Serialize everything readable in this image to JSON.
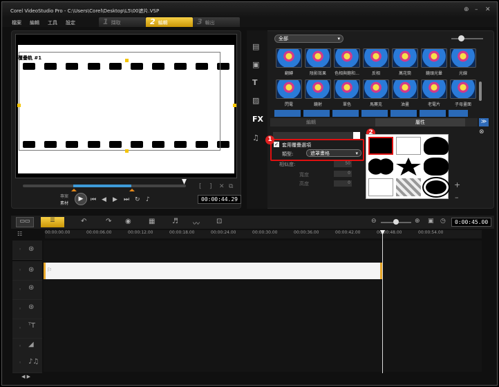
{
  "app": {
    "title": "Corel VideoStudio Pro - C:\\Users\\Corel\\Desktop\\L5\\00遮片.VSP"
  },
  "menu": [
    "檔案",
    "編輯",
    "工具",
    "設定"
  ],
  "steps": [
    {
      "num": "1",
      "label": "擷取"
    },
    {
      "num": "2",
      "label": "編輯"
    },
    {
      "num": "3",
      "label": "輸出"
    }
  ],
  "preview": {
    "overlay_tag": "覆疊軌 #1",
    "mode_top": "專案",
    "mode_bottom": "素材",
    "timecode": "00:00:44.29"
  },
  "library": {
    "category": "全部",
    "tab_edit": "編輯",
    "tab_attr": "屬性",
    "row1": [
      "翻轉",
      "陰影效果",
      "色相與飽和...",
      "反相",
      "萬花筒",
      "鏡頭光暈",
      "光線"
    ],
    "row2": [
      "閃電",
      "鏡射",
      "單色",
      "馬賽克",
      "油畫",
      "老電片",
      "子母畫面"
    ]
  },
  "attr": {
    "checkbox_label": "套用覆疊選項",
    "type_label": "類型:",
    "type_value": "遮罩畫格",
    "similarity_label": "相似度:",
    "width_label": "寬度",
    "height_label": "高度",
    "num1": "50",
    "num2": "0",
    "num3": "0"
  },
  "badges": {
    "b1": "1",
    "b2": "2"
  },
  "timeline": {
    "timecode": "0:00:45.00",
    "ticks": [
      "00:00:00.00",
      "00:00:06.00",
      "00:00:12.00",
      "00:00:18.00",
      "00:00:24.00",
      "00:00:30.00",
      "00:00:36.00",
      "00:00:42.00",
      "00:00:48.00",
      "00:00:54.00"
    ]
  },
  "colors": {
    "accent": "#f4c400",
    "badge": "#e02020"
  }
}
